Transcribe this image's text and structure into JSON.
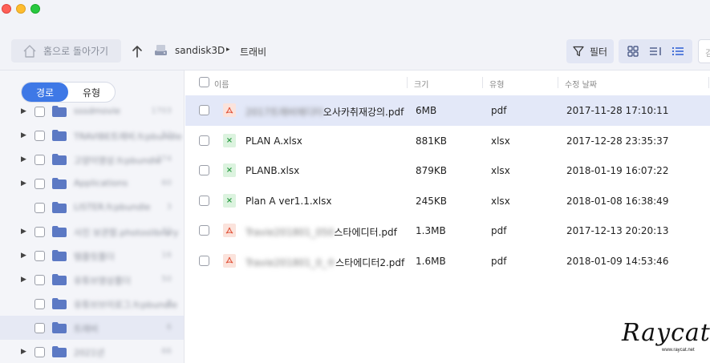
{
  "window": {
    "traffic_lights": [
      "close",
      "minimize",
      "zoom"
    ]
  },
  "toolbar": {
    "home_label": "홈으로 돌아가기",
    "breadcrumb_drive": "sandisk3D",
    "breadcrumb_separator": "▸",
    "breadcrumb_current": "트래비",
    "filter_label": "필터",
    "search_placeholder": "검"
  },
  "sidebar": {
    "tabs": [
      {
        "label": "경로",
        "active": true
      },
      {
        "label": "유형",
        "active": false
      }
    ],
    "items": [
      {
        "name": "sssdmovie",
        "count": "1703",
        "expandable": true,
        "selected": false
      },
      {
        "name": "TRAVIBE트래비.fcpbundle",
        "count": "52",
        "expandable": true,
        "selected": false
      },
      {
        "name": "고양이영상.fcpbundle",
        "count": "374",
        "expandable": true,
        "selected": false
      },
      {
        "name": "Applications",
        "count": "60",
        "expandable": true,
        "selected": false
      },
      {
        "name": "LISTER.fcpbundle",
        "count": "3",
        "expandable": false,
        "selected": false
      },
      {
        "name": "사진 보관함.photoslibrary",
        "count": "32",
        "expandable": true,
        "selected": false
      },
      {
        "name": "템플릿폴더",
        "count": "16",
        "expandable": true,
        "selected": false
      },
      {
        "name": "유튜브영상폴더",
        "count": "50",
        "expandable": true,
        "selected": false
      },
      {
        "name": "유튜브브이로그.fcpbundle",
        "count": "2",
        "expandable": false,
        "selected": false
      },
      {
        "name": "트래비",
        "count": "6",
        "expandable": false,
        "selected": true
      },
      {
        "name": "2021년",
        "count": "66",
        "expandable": true,
        "selected": false
      }
    ]
  },
  "file_list": {
    "columns": [
      "이름",
      "크기",
      "유형",
      "수정 날짜"
    ],
    "files": [
      {
        "blurred_prefix": "2017트래비에디터",
        "name": "오사카취재강의.pdf",
        "size": "6MB",
        "type": "pdf",
        "modified": "2017-11-28 17:10:11",
        "icon": "pdf-icon",
        "selected": true
      },
      {
        "blurred_prefix": "",
        "name": "PLAN A.xlsx",
        "size": "881KB",
        "type": "xlsx",
        "modified": "2017-12-28 23:35:37",
        "icon": "xlsx-icon",
        "selected": false
      },
      {
        "blurred_prefix": "",
        "name": "PLANB.xlsx",
        "size": "879KB",
        "type": "xlsx",
        "modified": "2018-01-19 16:07:22",
        "icon": "xlsx-icon",
        "selected": false
      },
      {
        "blurred_prefix": "",
        "name": "Plan A ver1.1.xlsx",
        "size": "245KB",
        "type": "xlsx",
        "modified": "2018-01-08 16:38:49",
        "icon": "xlsx-icon",
        "selected": false
      },
      {
        "blurred_prefix": "Travie201801_050",
        "name": "스타에디터.pdf",
        "size": "1.3MB",
        "type": "pdf",
        "modified": "2017-12-13 20:20:13",
        "icon": "pdf-icon",
        "selected": false
      },
      {
        "blurred_prefix": "Travie201801_0_수",
        "name": "스타에디터2.pdf",
        "size": "1.6MB",
        "type": "pdf",
        "modified": "2018-01-09 14:53:46",
        "icon": "pdf-icon",
        "selected": false
      }
    ]
  },
  "watermark": {
    "script": "Raycat",
    "url": "www.raycat.net"
  },
  "colors": {
    "accent": "#3e78e6",
    "selected_row": "#e3e8f8",
    "pdf": "#e2543a",
    "xlsx": "#2e9e47"
  }
}
